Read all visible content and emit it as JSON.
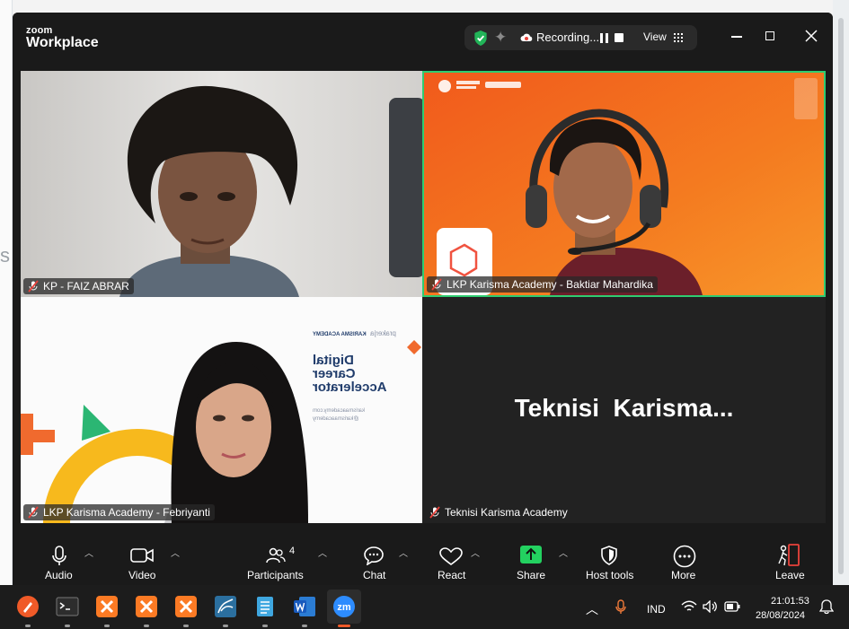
{
  "window": {
    "logo_top": "zoom",
    "logo_main": "Workplace",
    "recording_label": "Recording...",
    "view_label": "View"
  },
  "participants": [
    {
      "name": "KP - FAIZ ABRAR",
      "muted": true
    },
    {
      "name": "LKP Karisma Academy - Baktiar Mahardika",
      "muted": true,
      "active_speaker": true
    },
    {
      "name": "LKP Karisma Academy - Febriyanti",
      "muted": true
    },
    {
      "name": "Teknisi Karisma Academy",
      "muted": true,
      "display_text": "Teknisi  Karisma..."
    }
  ],
  "slide": {
    "brand": "prakerja",
    "brand_small": "KARISMA ACADEMY",
    "headline": [
      "Digital",
      "Career",
      "Accelerator"
    ],
    "line1": "karismaacademy.com",
    "line2": "@karismaacademy"
  },
  "toolbar": {
    "audio": "Audio",
    "video": "Video",
    "participants": "Participants",
    "participants_count": "4",
    "chat": "Chat",
    "react": "React",
    "share": "Share",
    "host_tools": "Host tools",
    "more": "More",
    "leave": "Leave"
  },
  "taskbar": {
    "language": "IND",
    "time": "21:01:53",
    "date": "28/08/2024"
  },
  "colors": {
    "active_border": "#2ecc71",
    "share_green": "#23d160",
    "leave_red": "#e8423b",
    "orange_bg": "#f36f1d"
  },
  "desktop": {
    "edge_letter": "s"
  }
}
